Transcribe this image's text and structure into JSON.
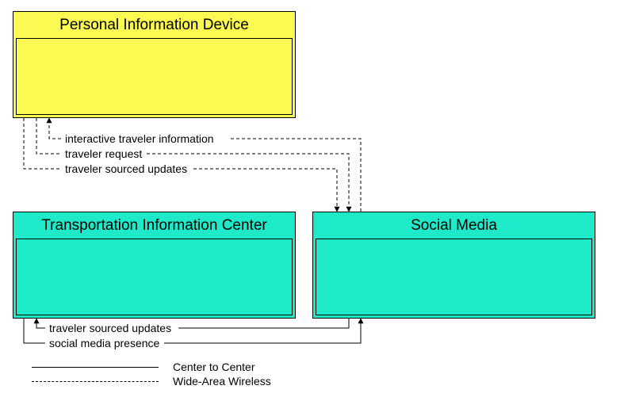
{
  "nodes": {
    "pid": {
      "title": "Personal Information Device"
    },
    "tic": {
      "title": "Transportation Information Center"
    },
    "sm": {
      "title": "Social Media"
    }
  },
  "flows": {
    "interactive_traveler_information": "interactive traveler information",
    "traveler_request": "traveler request",
    "traveler_sourced_updates_top": "traveler sourced updates",
    "traveler_sourced_updates_bottom": "traveler sourced updates",
    "social_media_presence": "social media presence"
  },
  "legend": {
    "center_to_center": "Center to Center",
    "wide_area_wireless": "Wide-Area Wireless"
  },
  "chart_data": {
    "type": "diagram",
    "title": "",
    "nodes": [
      {
        "id": "pid",
        "label": "Personal Information Device",
        "color": "#fafa52"
      },
      {
        "id": "tic",
        "label": "Transportation Information Center",
        "color": "#1eeaca"
      },
      {
        "id": "sm",
        "label": "Social Media",
        "color": "#1eeaca"
      }
    ],
    "edges": [
      {
        "from": "sm",
        "to": "pid",
        "label": "interactive traveler information",
        "link_type": "Wide-Area Wireless"
      },
      {
        "from": "pid",
        "to": "sm",
        "label": "traveler request",
        "link_type": "Wide-Area Wireless"
      },
      {
        "from": "pid",
        "to": "sm",
        "label": "traveler sourced updates",
        "link_type": "Wide-Area Wireless"
      },
      {
        "from": "sm",
        "to": "tic",
        "label": "traveler sourced updates",
        "link_type": "Center to Center"
      },
      {
        "from": "tic",
        "to": "sm",
        "label": "social media presence",
        "link_type": "Center to Center"
      }
    ],
    "legend": [
      {
        "style": "solid",
        "label": "Center to Center"
      },
      {
        "style": "dashed",
        "label": "Wide-Area Wireless"
      }
    ]
  }
}
